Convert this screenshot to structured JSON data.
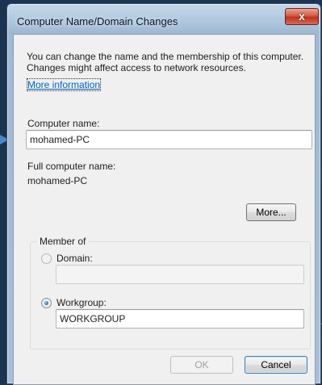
{
  "window": {
    "title": "Computer Name/Domain Changes",
    "close_label": "x",
    "close_icon": "close-icon"
  },
  "intro": {
    "text": "You can change the name and the membership of this computer. Changes might affect access to network resources.",
    "more_info_link": "More information"
  },
  "computer_name": {
    "label": "Computer name:",
    "value": "mohamed-PC"
  },
  "full_computer_name": {
    "label": "Full computer name:",
    "value": "mohamed-PC"
  },
  "more_button": "More...",
  "member_of": {
    "title": "Member of",
    "domain": {
      "label": "Domain:",
      "value": "",
      "selected": false
    },
    "workgroup": {
      "label": "Workgroup:",
      "value": "WORKGROUP",
      "selected": true
    }
  },
  "buttons": {
    "ok": "OK",
    "cancel": "Cancel"
  },
  "colors": {
    "link": "#0064c8",
    "desktop": "#1b3450",
    "close_button": "#c0321d"
  }
}
